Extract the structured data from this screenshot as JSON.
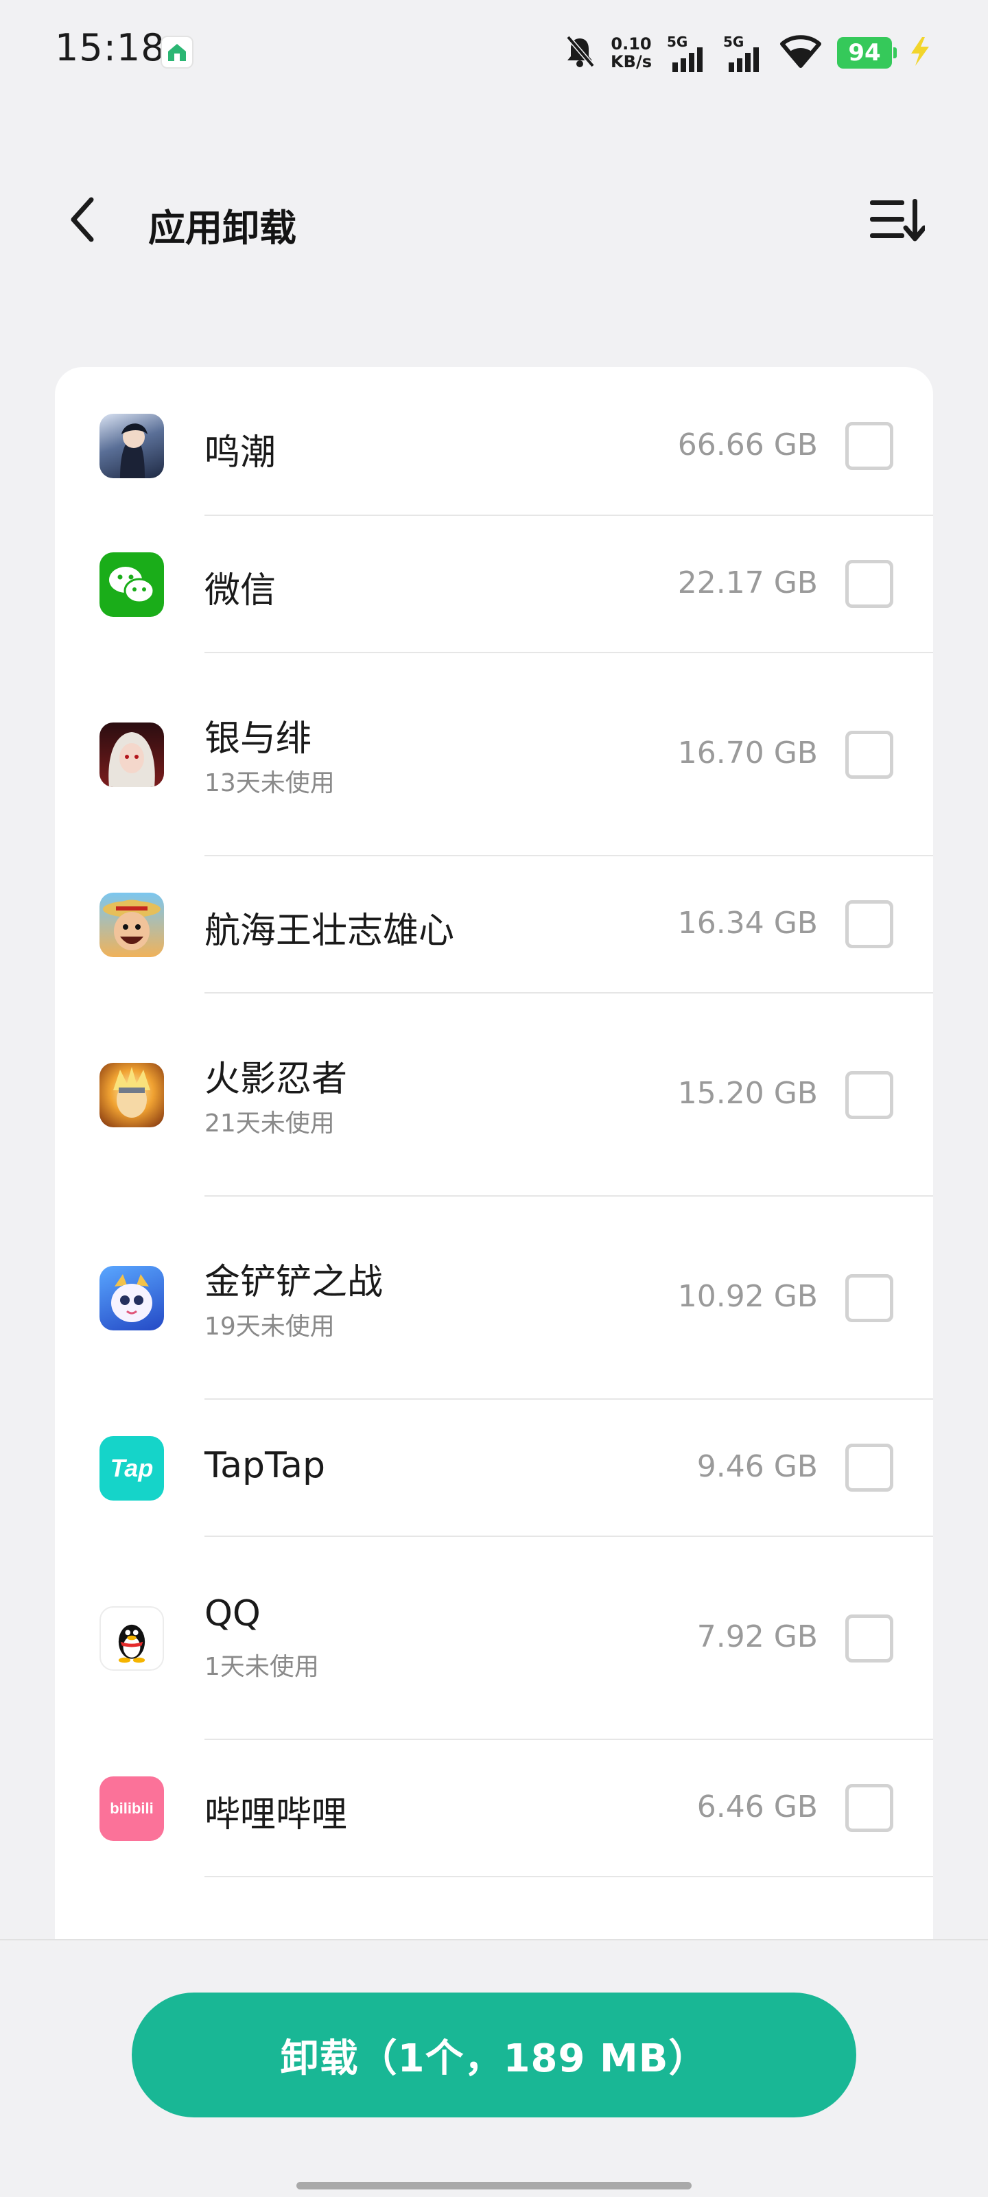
{
  "status_bar": {
    "time": "15:18",
    "net_speed_value": "0.10",
    "net_speed_unit": "KB/s",
    "signal_label_1": "5G",
    "signal_label_2": "5G",
    "battery": "94",
    "icons": [
      "app-store-icon",
      "mute-bell-icon",
      "signal-icon",
      "wifi-icon",
      "charging-icon"
    ]
  },
  "header": {
    "title": "应用卸载",
    "back_icon": "chevron-left-icon",
    "sort_icon": "sort-list-icon"
  },
  "apps": [
    {
      "name": "鸣潮",
      "sub": "",
      "size": "66.66 GB",
      "checked": false,
      "icon": "wuthering-waves-icon",
      "icon_color": "#3a4a68"
    },
    {
      "name": "微信",
      "sub": "",
      "size": "22.17 GB",
      "checked": false,
      "icon": "wechat-icon",
      "icon_color": "#1aad19"
    },
    {
      "name": "银与绯",
      "sub": "13天未使用",
      "size": "16.70 GB",
      "checked": false,
      "icon": "silver-and-crimson-icon",
      "icon_color": "#7a1c1c"
    },
    {
      "name": "航海王壮志雄心",
      "sub": "",
      "size": "16.34 GB",
      "checked": false,
      "icon": "one-piece-icon",
      "icon_color": "#d8862e"
    },
    {
      "name": "火影忍者",
      "sub": "21天未使用",
      "size": "15.20 GB",
      "checked": false,
      "icon": "naruto-icon",
      "icon_color": "#e0872a"
    },
    {
      "name": "金铲铲之战",
      "sub": "19天未使用",
      "size": "10.92 GB",
      "checked": false,
      "icon": "golden-spatula-icon",
      "icon_color": "#2f6fd8"
    },
    {
      "name": "TapTap",
      "sub": "",
      "size": "9.46 GB",
      "checked": false,
      "icon": "taptap-icon",
      "icon_color": "#15d4c9"
    },
    {
      "name": "QQ",
      "sub": "1天未使用",
      "size": "7.92 GB",
      "checked": false,
      "icon": "qq-penguin-icon",
      "icon_color": "#111111"
    },
    {
      "name": "哔哩哔哩",
      "sub": "",
      "size": "6.46 GB",
      "checked": false,
      "icon": "bilibili-icon",
      "icon_color": "#fb7299"
    }
  ],
  "taptap_logo_text": "Tap",
  "bilibili_logo_text": "bilibili",
  "footer": {
    "uninstall_label": "卸载（1个，189 MB）",
    "accent_color": "#19b795"
  }
}
